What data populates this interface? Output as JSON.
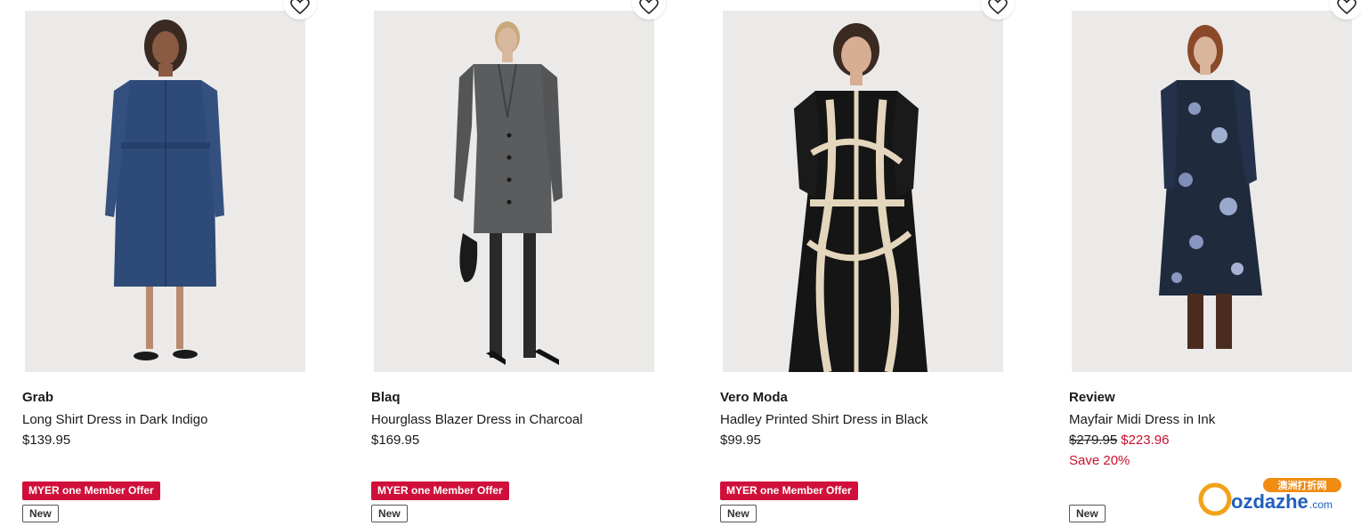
{
  "products": [
    {
      "brand": "Grab",
      "title": "Long Shirt Dress in Dark Indigo",
      "price": "$139.95",
      "offer_badge": "MYER one Member Offer",
      "new_badge": "New",
      "image_alt": "Long Shirt Dress in Dark Indigo"
    },
    {
      "brand": "Blaq",
      "title": "Hourglass Blazer Dress in Charcoal",
      "price": "$169.95",
      "offer_badge": "MYER one Member Offer",
      "new_badge": "New",
      "image_alt": "Hourglass Blazer Dress in Charcoal"
    },
    {
      "brand": "Vero Moda",
      "title": "Hadley Printed Shirt Dress in Black",
      "price": "$99.95",
      "offer_badge": "MYER one Member Offer",
      "new_badge": "New",
      "image_alt": "Hadley Printed Shirt Dress in Black"
    },
    {
      "brand": "Review",
      "title": "Mayfair Midi Dress in Ink",
      "price_was": "$279.95",
      "price_now": "$223.96",
      "save": "Save 20%",
      "new_badge": "New",
      "image_alt": "Mayfair Midi Dress in Ink"
    }
  ],
  "watermark": {
    "brand_text": "ozdazhe",
    "domain_text": ".com",
    "cn_text": "澳洲打折网"
  },
  "icons": {
    "wishlist": "heart-outline-icon"
  },
  "colors": {
    "sale_red": "#c8102e",
    "offer_badge_bg": "#d0103a",
    "image_bg": "#eceae8"
  }
}
